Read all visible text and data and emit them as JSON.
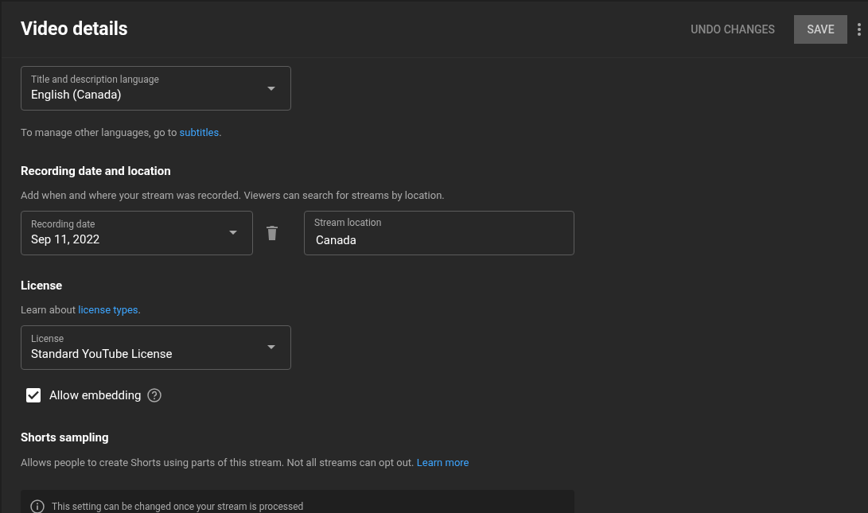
{
  "header": {
    "title": "Video details",
    "undo_button": "UNDO CHANGES",
    "save_button": "SAVE",
    "save_disabled": true
  },
  "language": {
    "label": "Title and description language",
    "value": "English (Canada)"
  },
  "language_note": {
    "text": "To manage other languages, go to ",
    "link": "subtitles",
    "after": "."
  },
  "recording": {
    "heading": "Recording date and location",
    "description": "Add when and where your stream was recorded. Viewers can search for streams by location.",
    "date": {
      "label": "Recording date",
      "value": "Sep 11, 2022"
    },
    "location": {
      "label": "Stream location",
      "value": "Canada"
    }
  },
  "license": {
    "heading": "License",
    "note": {
      "text": "Learn about ",
      "link": "license types",
      "after": "."
    },
    "select": {
      "label": "License",
      "value": "Standard YouTube License"
    },
    "embedding": {
      "label": "Allow embedding",
      "checked": true
    }
  },
  "shorts": {
    "heading": "Shorts sampling",
    "description": "Allows people to create Shorts using parts of this stream. Not all streams can opt out. ",
    "link": "Learn more",
    "notice": "This setting can be changed once your stream is processed"
  }
}
